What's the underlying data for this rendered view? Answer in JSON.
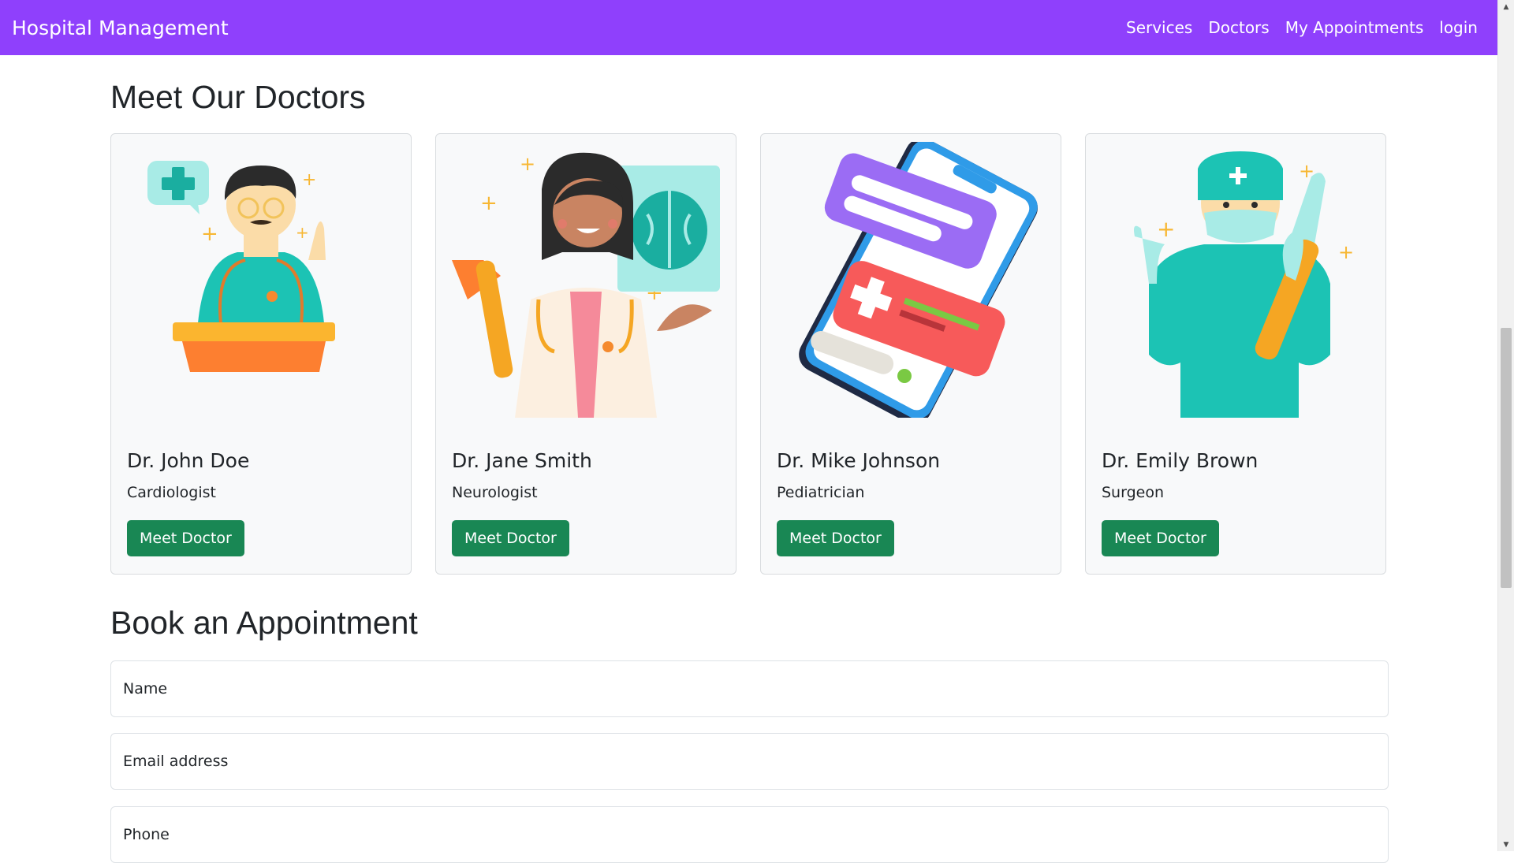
{
  "nav": {
    "brand": "Hospital Management",
    "links": [
      "Services",
      "Doctors",
      "My Appointments",
      "login"
    ]
  },
  "doctors_section": {
    "title": "Meet Our Doctors",
    "doctors": [
      {
        "name": "Dr. John Doe",
        "specialty": "Cardiologist",
        "button": "Meet Doctor"
      },
      {
        "name": "Dr. Jane Smith",
        "specialty": "Neurologist",
        "button": "Meet Doctor"
      },
      {
        "name": "Dr. Mike Johnson",
        "specialty": "Pediatrician",
        "button": "Meet Doctor"
      },
      {
        "name": "Dr. Emily Brown",
        "specialty": "Surgeon",
        "button": "Meet Doctor"
      }
    ]
  },
  "appointment_section": {
    "title": "Book an Appointment",
    "name_placeholder": "Name",
    "email_placeholder": "Email address",
    "phone_placeholder": "Phone"
  },
  "colors": {
    "navbar": "#8f40fc",
    "button": "#198754",
    "card_bg": "#f8f9fa"
  }
}
